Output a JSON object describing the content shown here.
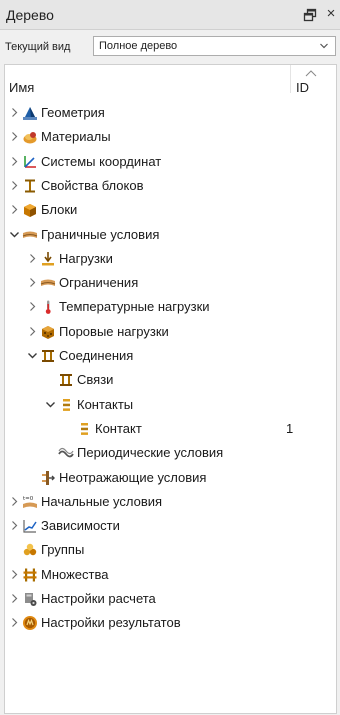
{
  "panel": {
    "title": "Дерево",
    "undock_icon": "undock-icon",
    "close_glyph": "×"
  },
  "view": {
    "label": "Текущий вид",
    "selected": "Полное дерево"
  },
  "columns": {
    "name": "Имя",
    "id": "ID"
  },
  "tree": [
    {
      "label": "Геометрия",
      "icon": "geometry-icon",
      "toggle": "collapsed",
      "depth": 0,
      "id": ""
    },
    {
      "label": "Материалы",
      "icon": "materials-icon",
      "toggle": "collapsed",
      "depth": 0,
      "id": ""
    },
    {
      "label": "Системы координат",
      "icon": "coordinate-systems-icon",
      "toggle": "collapsed",
      "depth": 0,
      "id": ""
    },
    {
      "label": "Свойства блоков",
      "icon": "block-properties-icon",
      "toggle": "collapsed",
      "depth": 0,
      "id": ""
    },
    {
      "label": "Блоки",
      "icon": "blocks-icon",
      "toggle": "collapsed",
      "depth": 0,
      "id": ""
    },
    {
      "label": "Граничные условия",
      "icon": "boundary-conditions-icon",
      "toggle": "expanded",
      "depth": 0,
      "id": ""
    },
    {
      "label": "Нагрузки",
      "icon": "loads-icon",
      "toggle": "collapsed",
      "depth": 1,
      "id": ""
    },
    {
      "label": "Ограничения",
      "icon": "constraints-icon",
      "toggle": "collapsed",
      "depth": 1,
      "id": ""
    },
    {
      "label": "Температурные нагрузки",
      "icon": "thermometer-icon",
      "toggle": "collapsed",
      "depth": 1,
      "id": ""
    },
    {
      "label": "Поровые нагрузки",
      "icon": "pore-loads-icon",
      "toggle": "collapsed",
      "depth": 1,
      "id": ""
    },
    {
      "label": "Соединения",
      "icon": "connections-icon",
      "toggle": "expanded",
      "depth": 1,
      "id": ""
    },
    {
      "label": "Связи",
      "icon": "ties-icon",
      "toggle": "none",
      "depth": 2,
      "id": ""
    },
    {
      "label": "Контакты",
      "icon": "contacts-icon",
      "toggle": "expanded",
      "depth": 2,
      "id": ""
    },
    {
      "label": "Контакт",
      "icon": "contact-icon",
      "toggle": "none",
      "depth": 3,
      "id": "1"
    },
    {
      "label": "Периодические условия",
      "icon": "periodic-conditions-icon",
      "toggle": "none",
      "depth": 2,
      "id": ""
    },
    {
      "label": "Неотражающие условия",
      "icon": "non-reflecting-icon",
      "toggle": "none",
      "depth": 1,
      "id": ""
    },
    {
      "label": "Начальные условия",
      "icon": "initial-conditions-icon",
      "toggle": "collapsed",
      "depth": 0,
      "id": ""
    },
    {
      "label": "Зависимости",
      "icon": "dependencies-icon",
      "toggle": "collapsed",
      "depth": 0,
      "id": ""
    },
    {
      "label": "Группы",
      "icon": "groups-icon",
      "toggle": "none",
      "depth": 0,
      "id": ""
    },
    {
      "label": "Множества",
      "icon": "sets-icon",
      "toggle": "collapsed",
      "depth": 0,
      "id": ""
    },
    {
      "label": "Настройки расчета",
      "icon": "analysis-settings-icon",
      "toggle": "collapsed",
      "depth": 0,
      "id": ""
    },
    {
      "label": "Настройки результатов",
      "icon": "results-settings-icon",
      "toggle": "collapsed",
      "depth": 0,
      "id": ""
    }
  ],
  "icon_text": {
    "initial_conditions": "t=0"
  }
}
